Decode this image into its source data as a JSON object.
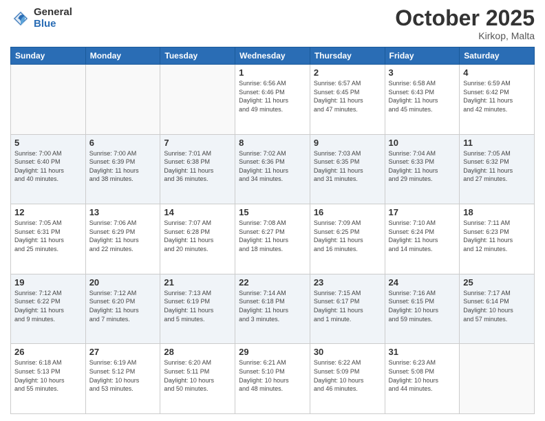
{
  "logo": {
    "general": "General",
    "blue": "Blue"
  },
  "header": {
    "month": "October 2025",
    "location": "Kirkop, Malta"
  },
  "weekdays": [
    "Sunday",
    "Monday",
    "Tuesday",
    "Wednesday",
    "Thursday",
    "Friday",
    "Saturday"
  ],
  "weeks": [
    [
      {
        "day": "",
        "info": ""
      },
      {
        "day": "",
        "info": ""
      },
      {
        "day": "",
        "info": ""
      },
      {
        "day": "1",
        "info": "Sunrise: 6:56 AM\nSunset: 6:46 PM\nDaylight: 11 hours\nand 49 minutes."
      },
      {
        "day": "2",
        "info": "Sunrise: 6:57 AM\nSunset: 6:45 PM\nDaylight: 11 hours\nand 47 minutes."
      },
      {
        "day": "3",
        "info": "Sunrise: 6:58 AM\nSunset: 6:43 PM\nDaylight: 11 hours\nand 45 minutes."
      },
      {
        "day": "4",
        "info": "Sunrise: 6:59 AM\nSunset: 6:42 PM\nDaylight: 11 hours\nand 42 minutes."
      }
    ],
    [
      {
        "day": "5",
        "info": "Sunrise: 7:00 AM\nSunset: 6:40 PM\nDaylight: 11 hours\nand 40 minutes."
      },
      {
        "day": "6",
        "info": "Sunrise: 7:00 AM\nSunset: 6:39 PM\nDaylight: 11 hours\nand 38 minutes."
      },
      {
        "day": "7",
        "info": "Sunrise: 7:01 AM\nSunset: 6:38 PM\nDaylight: 11 hours\nand 36 minutes."
      },
      {
        "day": "8",
        "info": "Sunrise: 7:02 AM\nSunset: 6:36 PM\nDaylight: 11 hours\nand 34 minutes."
      },
      {
        "day": "9",
        "info": "Sunrise: 7:03 AM\nSunset: 6:35 PM\nDaylight: 11 hours\nand 31 minutes."
      },
      {
        "day": "10",
        "info": "Sunrise: 7:04 AM\nSunset: 6:33 PM\nDaylight: 11 hours\nand 29 minutes."
      },
      {
        "day": "11",
        "info": "Sunrise: 7:05 AM\nSunset: 6:32 PM\nDaylight: 11 hours\nand 27 minutes."
      }
    ],
    [
      {
        "day": "12",
        "info": "Sunrise: 7:05 AM\nSunset: 6:31 PM\nDaylight: 11 hours\nand 25 minutes."
      },
      {
        "day": "13",
        "info": "Sunrise: 7:06 AM\nSunset: 6:29 PM\nDaylight: 11 hours\nand 22 minutes."
      },
      {
        "day": "14",
        "info": "Sunrise: 7:07 AM\nSunset: 6:28 PM\nDaylight: 11 hours\nand 20 minutes."
      },
      {
        "day": "15",
        "info": "Sunrise: 7:08 AM\nSunset: 6:27 PM\nDaylight: 11 hours\nand 18 minutes."
      },
      {
        "day": "16",
        "info": "Sunrise: 7:09 AM\nSunset: 6:25 PM\nDaylight: 11 hours\nand 16 minutes."
      },
      {
        "day": "17",
        "info": "Sunrise: 7:10 AM\nSunset: 6:24 PM\nDaylight: 11 hours\nand 14 minutes."
      },
      {
        "day": "18",
        "info": "Sunrise: 7:11 AM\nSunset: 6:23 PM\nDaylight: 11 hours\nand 12 minutes."
      }
    ],
    [
      {
        "day": "19",
        "info": "Sunrise: 7:12 AM\nSunset: 6:22 PM\nDaylight: 11 hours\nand 9 minutes."
      },
      {
        "day": "20",
        "info": "Sunrise: 7:12 AM\nSunset: 6:20 PM\nDaylight: 11 hours\nand 7 minutes."
      },
      {
        "day": "21",
        "info": "Sunrise: 7:13 AM\nSunset: 6:19 PM\nDaylight: 11 hours\nand 5 minutes."
      },
      {
        "day": "22",
        "info": "Sunrise: 7:14 AM\nSunset: 6:18 PM\nDaylight: 11 hours\nand 3 minutes."
      },
      {
        "day": "23",
        "info": "Sunrise: 7:15 AM\nSunset: 6:17 PM\nDaylight: 11 hours\nand 1 minute."
      },
      {
        "day": "24",
        "info": "Sunrise: 7:16 AM\nSunset: 6:15 PM\nDaylight: 10 hours\nand 59 minutes."
      },
      {
        "day": "25",
        "info": "Sunrise: 7:17 AM\nSunset: 6:14 PM\nDaylight: 10 hours\nand 57 minutes."
      }
    ],
    [
      {
        "day": "26",
        "info": "Sunrise: 6:18 AM\nSunset: 5:13 PM\nDaylight: 10 hours\nand 55 minutes."
      },
      {
        "day": "27",
        "info": "Sunrise: 6:19 AM\nSunset: 5:12 PM\nDaylight: 10 hours\nand 53 minutes."
      },
      {
        "day": "28",
        "info": "Sunrise: 6:20 AM\nSunset: 5:11 PM\nDaylight: 10 hours\nand 50 minutes."
      },
      {
        "day": "29",
        "info": "Sunrise: 6:21 AM\nSunset: 5:10 PM\nDaylight: 10 hours\nand 48 minutes."
      },
      {
        "day": "30",
        "info": "Sunrise: 6:22 AM\nSunset: 5:09 PM\nDaylight: 10 hours\nand 46 minutes."
      },
      {
        "day": "31",
        "info": "Sunrise: 6:23 AM\nSunset: 5:08 PM\nDaylight: 10 hours\nand 44 minutes."
      },
      {
        "day": "",
        "info": ""
      }
    ]
  ]
}
